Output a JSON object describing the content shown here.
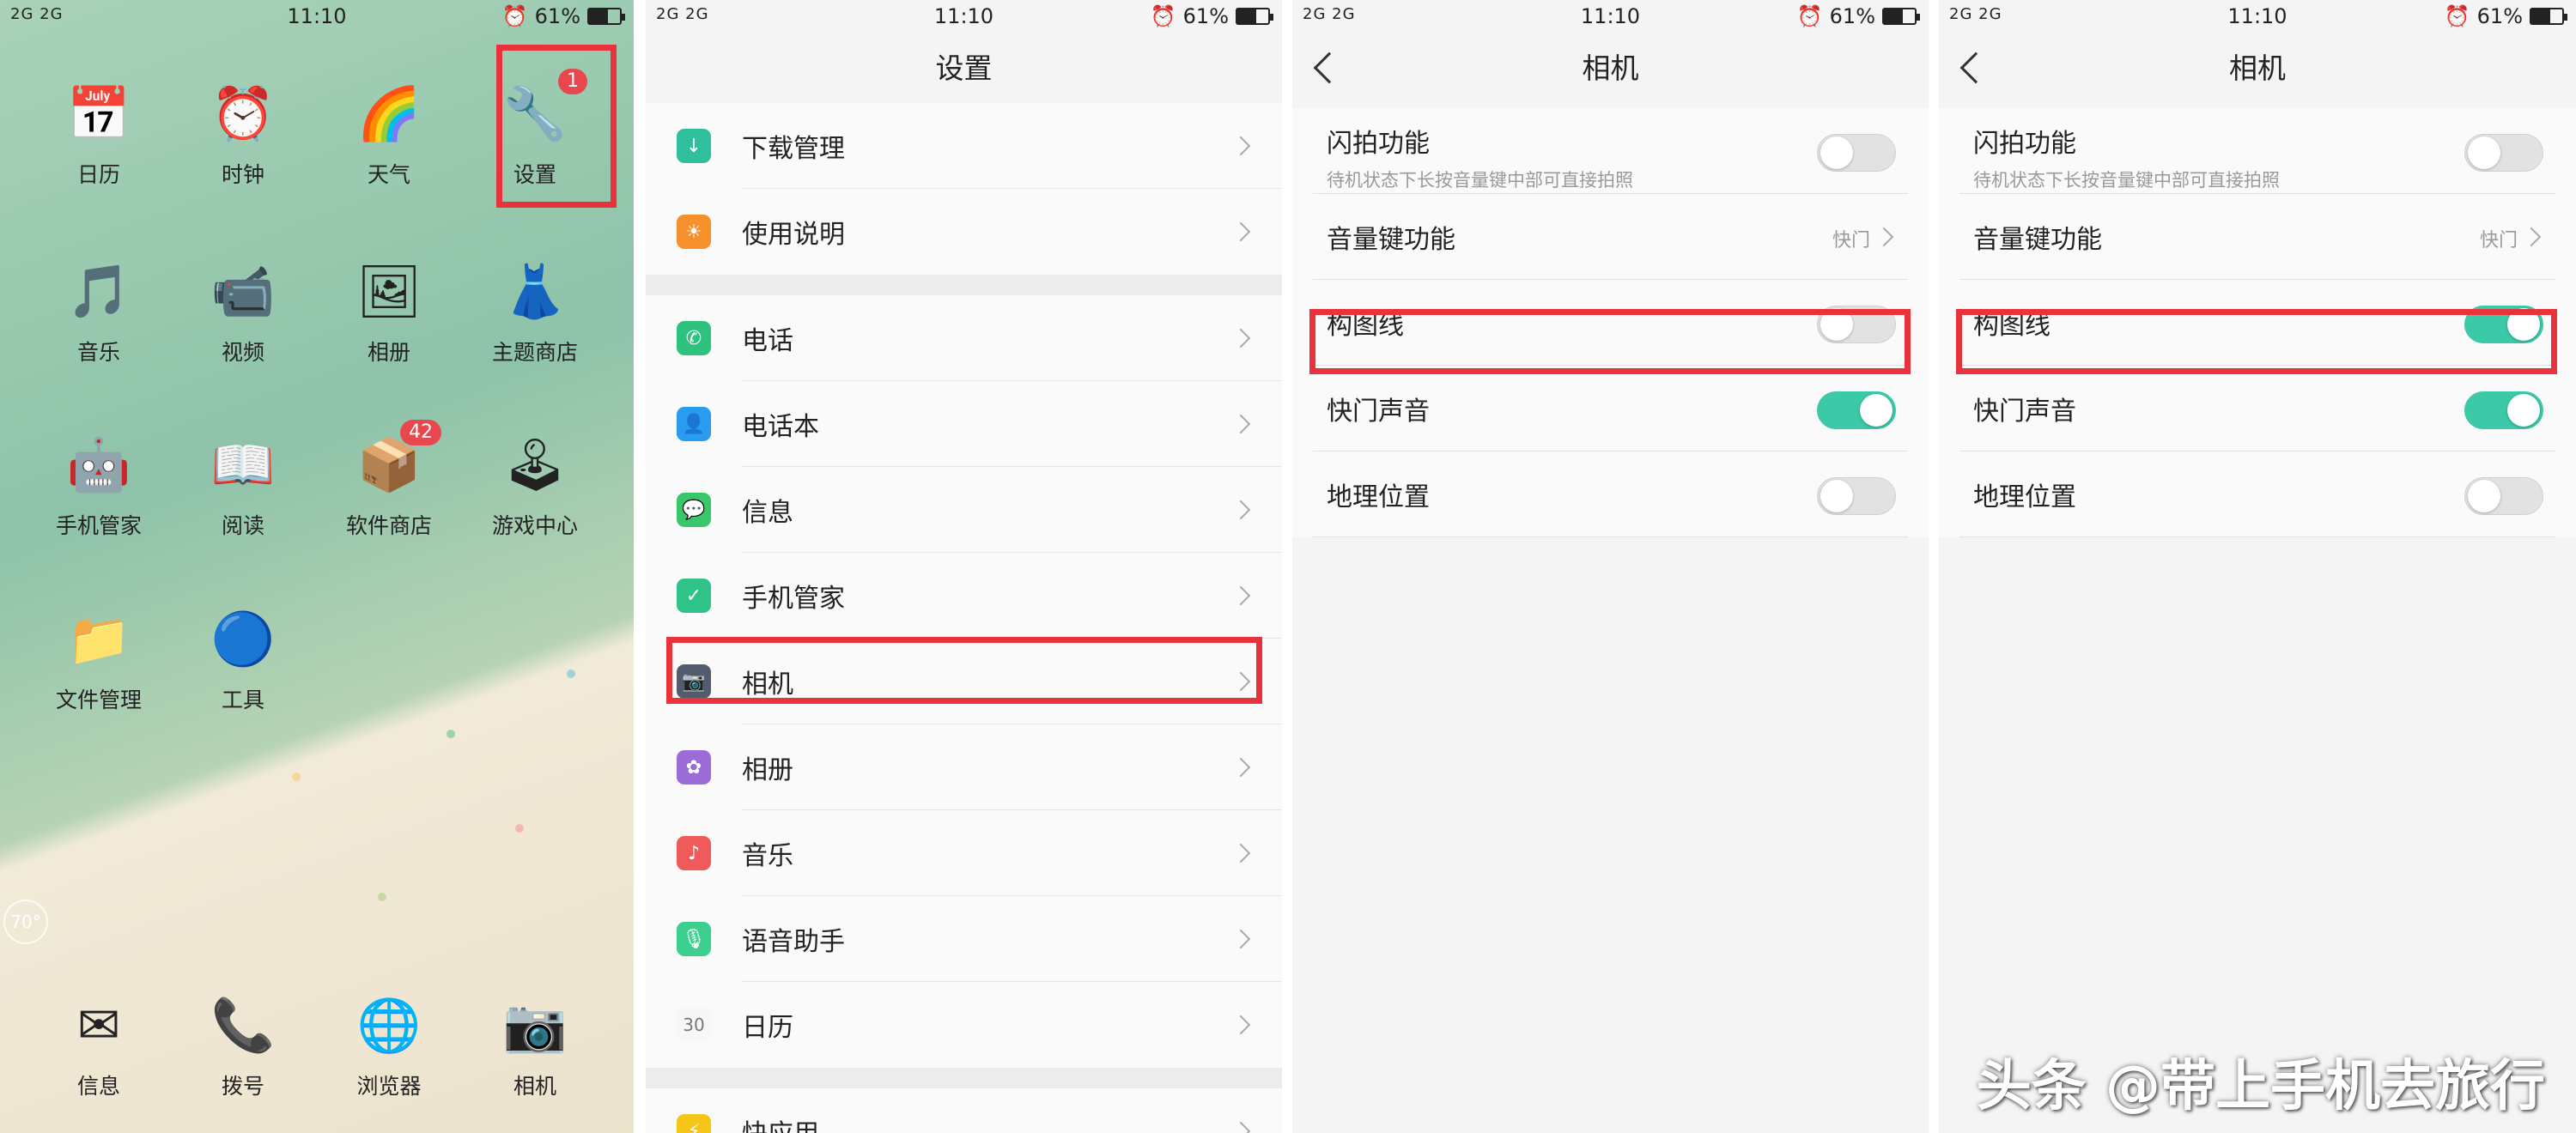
{
  "status_bar": {
    "signal": "2G 2G",
    "time": "11:10",
    "battery": "61%",
    "battery_level": 0.61
  },
  "home": {
    "apps": [
      {
        "label": "日历",
        "icon": "calendar-icon"
      },
      {
        "label": "时钟",
        "icon": "clock-icon"
      },
      {
        "label": "天气",
        "icon": "weather-icon"
      },
      {
        "label": "设置",
        "icon": "settings-icon",
        "badge": "1"
      },
      {
        "label": "音乐",
        "icon": "music-icon"
      },
      {
        "label": "视频",
        "icon": "video-icon"
      },
      {
        "label": "相册",
        "icon": "album-icon"
      },
      {
        "label": "主题商店",
        "icon": "theme-store-icon"
      },
      {
        "label": "手机管家",
        "icon": "phone-manager-icon"
      },
      {
        "label": "阅读",
        "icon": "reading-icon"
      },
      {
        "label": "软件商店",
        "icon": "app-store-icon",
        "badge": "42"
      },
      {
        "label": "游戏中心",
        "icon": "game-center-icon"
      },
      {
        "label": "文件管理",
        "icon": "file-manager-icon"
      },
      {
        "label": "工具",
        "icon": "tools-folder-icon"
      }
    ],
    "dock": [
      {
        "label": "信息",
        "icon": "messages-icon"
      },
      {
        "label": "拨号",
        "icon": "dialer-icon"
      },
      {
        "label": "浏览器",
        "icon": "browser-icon"
      },
      {
        "label": "相机",
        "icon": "camera-icon"
      }
    ],
    "temperature": "70°"
  },
  "settings": {
    "title": "设置",
    "group1": [
      {
        "label": "下载管理",
        "icon": "download-icon",
        "color": "#2fbf9c"
      },
      {
        "label": "使用说明",
        "icon": "bulb-icon",
        "color": "#f5902a"
      }
    ],
    "group2": [
      {
        "label": "电话",
        "icon": "phone-icon",
        "color": "#2ec27e"
      },
      {
        "label": "电话本",
        "icon": "contacts-icon",
        "color": "#2a9cf0"
      },
      {
        "label": "信息",
        "icon": "message-icon",
        "color": "#3ac66a"
      },
      {
        "label": "手机管家",
        "icon": "shield-icon",
        "color": "#2fc38a"
      },
      {
        "label": "相机",
        "icon": "camera-icon",
        "color": "#555b6e"
      },
      {
        "label": "相册",
        "icon": "flower-icon",
        "color": "#9b6bd8"
      },
      {
        "label": "音乐",
        "icon": "music-note-icon",
        "color": "#ef5a5a"
      },
      {
        "label": "语音助手",
        "icon": "mic-icon",
        "color": "#3ccf8e"
      },
      {
        "label": "日历",
        "icon": "calendar-icon",
        "color": "#f7f7f7",
        "text": "30"
      }
    ],
    "group3": [
      {
        "label": "快应用",
        "icon": "quick-app-icon",
        "color": "#f5c518"
      }
    ]
  },
  "camera_before": {
    "title": "相机",
    "rows": [
      {
        "label": "闪拍功能",
        "sub": "待机状态下长按音量键中部可直接拍照",
        "type": "toggle",
        "on": false
      },
      {
        "label": "音量键功能",
        "value": "快门",
        "type": "nav"
      },
      {
        "label": "构图线",
        "type": "toggle",
        "on": false
      },
      {
        "label": "快门声音",
        "type": "toggle",
        "on": true
      },
      {
        "label": "地理位置",
        "type": "toggle",
        "on": false
      }
    ]
  },
  "camera_after": {
    "title": "相机",
    "rows": [
      {
        "label": "闪拍功能",
        "sub": "待机状态下长按音量键中部可直接拍照",
        "type": "toggle",
        "on": false
      },
      {
        "label": "音量键功能",
        "value": "快门",
        "type": "nav"
      },
      {
        "label": "构图线",
        "type": "toggle",
        "on": true
      },
      {
        "label": "快门声音",
        "type": "toggle",
        "on": true
      },
      {
        "label": "地理位置",
        "type": "toggle",
        "on": false
      }
    ]
  },
  "watermark": "头条 @带上手机去旅行"
}
